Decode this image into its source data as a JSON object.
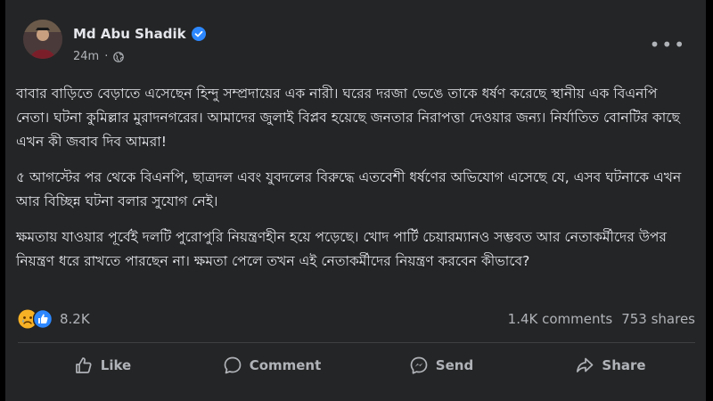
{
  "post": {
    "author": "Md Abu Shadik",
    "time": "24m",
    "paragraphs": [
      "বাবার বাড়িতে বেড়াতে এসেছেন হিন্দু সম্প্রদায়ের এক নারী। ঘরের দরজা ভেঙে তাকে ধর্ষণ করেছে স্থানীয় এক বিএনপি নেতা। ঘটনা কুমিল্লার মুরাদনগরের। আমাদের জুলাই বিপ্লব হয়েছে জনতার নিরাপত্তা দেওয়ার জন্য। নির্যাতিত বোনটির কাছে এখন কী জবাব দিব আমরা!",
      "৫ আগস্টের পর থেকে বিএনপি, ছাত্রদল এবং যুবদলের বিরুদ্ধে এতবেশী ধর্ষণের অভিযোগ এসেছে যে, এসব ঘটনাকে এখন আর বিচ্ছিন্ন ঘটনা বলার সুযোগ নেই।",
      "ক্ষমতায় যাওয়ার পূর্বেই দলটি পুরোপুরি নিয়ন্ত্রণহীন হয়ে পড়েছে। খোদ পার্টি চেয়ারম্যানও সম্ভবত আর নেতাকর্মীদের উপর নিয়ন্ত্রণ ধরে রাখতে পারছেন না। ক্ষমতা পেলে তখন এই নেতাকর্মীদের নিয়ন্ত্রণ করবেন কীভাবে?"
    ]
  },
  "reactions": {
    "count": "8.2K",
    "icons": [
      "sad-react-icon",
      "like-react-icon"
    ],
    "comments": "1.4K comments",
    "shares": "753 shares"
  },
  "actions": {
    "like": "Like",
    "comment": "Comment",
    "send": "Send",
    "share": "Share"
  },
  "colors": {
    "background": "#000000",
    "card": "#242526",
    "text": "#e4e6eb",
    "secondary_text": "#b0b3b8",
    "accent": "#2d88ff"
  }
}
